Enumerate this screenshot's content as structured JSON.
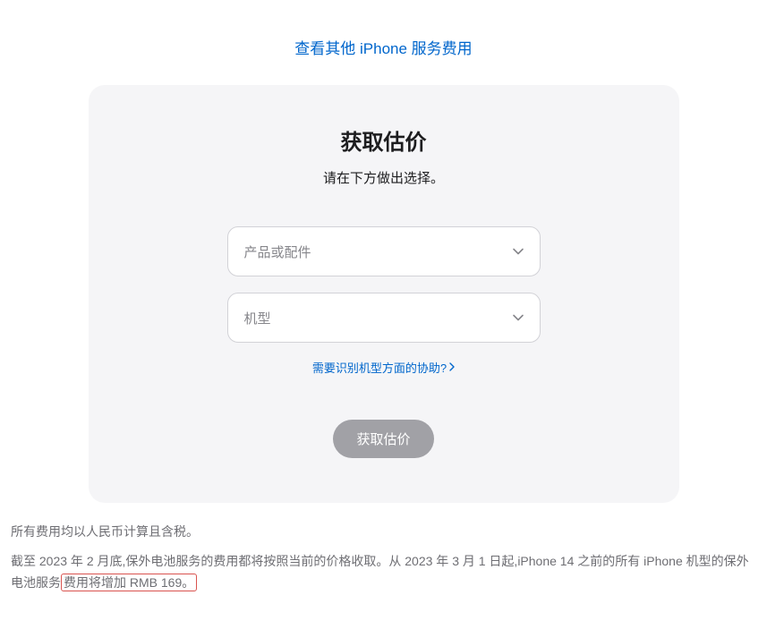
{
  "topLink": {
    "label": "查看其他 iPhone 服务费用"
  },
  "card": {
    "title": "获取估价",
    "subtitle": "请在下方做出选择。",
    "select1": {
      "placeholder": "产品或配件"
    },
    "select2": {
      "placeholder": "机型"
    },
    "helpLink": "需要识别机型方面的协助?",
    "button": "获取估价"
  },
  "footnote1": "所有费用均以人民币计算且含税。",
  "footnote2": {
    "prefix": "截至 2023 年 2 月底,保外电池服务的费用都将按照当前的价格收取。从 2023 年 3 月 1 日起,iPhone 14 之前的所有 iPhone 机型的保外电池服务",
    "highlighted": "费用将增加 RMB 169。"
  }
}
